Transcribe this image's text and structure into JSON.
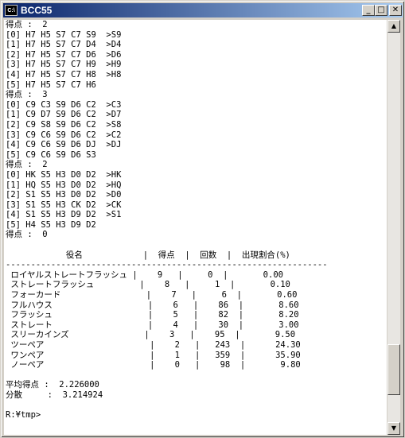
{
  "window": {
    "title": "BCC55",
    "icon_label": "C:\\",
    "minimize_glyph": "_",
    "maximize_glyph": "□",
    "close_glyph": "✕"
  },
  "scrollbar": {
    "up_glyph": "▲",
    "down_glyph": "▼",
    "position": 0.92
  },
  "console": {
    "lines": [
      "得点 :  2",
      "[0] H7 H5 S7 C7 S9  >S9",
      "[1] H7 H5 S7 C7 D4  >D4",
      "[2] H7 H5 S7 C7 D6  >D6",
      "[3] H7 H5 S7 C7 H9  >H9",
      "[4] H7 H5 S7 C7 H8  >H8",
      "[5] H7 H5 S7 C7 H6",
      "得点 :  3",
      "[0] C9 C3 S9 D6 C2  >C3",
      "[1] C9 D7 S9 D6 C2  >D7",
      "[2] C9 S8 S9 D6 C2  >S8",
      "[3] C9 C6 S9 D6 C2  >C2",
      "[4] C9 C6 S9 D6 DJ  >DJ",
      "[5] C9 C6 S9 D6 S3",
      "得点 :  2",
      "[0] HK S5 H3 D0 D2  >HK",
      "[1] HQ S5 H3 D0 D2  >HQ",
      "[2] S1 S5 H3 D0 D2  >D0",
      "[3] S1 S5 H3 CK D2  >CK",
      "[4] S1 S5 H3 D9 D2  >S1",
      "[5] H4 S5 H3 D9 D2",
      "得点 :  0",
      "",
      "            役名            |  得点  |  回数  |  出現割合(%)",
      "----------------------------------------------------------------",
      " ロイヤルストレートフラッシュ |    9   |     0  |       0.00",
      " ストレートフラッシュ         |    8   |     1  |       0.10",
      " フォーカード                 |    7   |     6  |       0.60",
      " フルハウス                   |    6   |    86  |       8.60",
      " フラッシュ                   |    5   |    82  |       8.20",
      " ストレート                   |    4   |    30  |       3.00",
      " スリーカインズ               |    3   |    95  |       9.50",
      " ツーペア                     |    2   |   243  |      24.30",
      " ワンペア                     |    1   |   359  |      35.90",
      " ノーペア                     |    0   |    98  |       9.80",
      "",
      "平均得点 :  2.226000",
      "分散     :  3.214924",
      "",
      "R:¥tmp>"
    ]
  }
}
